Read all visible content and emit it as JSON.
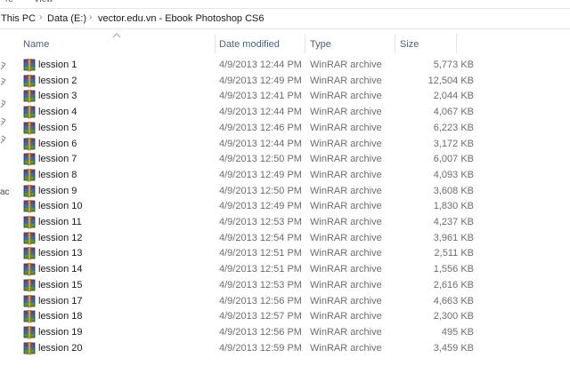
{
  "address": {
    "crumbs": [
      "This PC",
      "Data (E:)",
      "vector.edu.vn - Ebook Photoshop CS6"
    ]
  },
  "columns": {
    "name": "Name",
    "date_modified": "Date modified",
    "type": "Type",
    "size": "Size"
  },
  "nav_partial_letter": "ac",
  "files": [
    {
      "name": "lession 1",
      "date": "4/9/2013 12:44 PM",
      "type": "WinRAR archive",
      "size": "5,773 KB"
    },
    {
      "name": "lession 2",
      "date": "4/9/2013 12:49 PM",
      "type": "WinRAR archive",
      "size": "12,504 KB"
    },
    {
      "name": "lession 3",
      "date": "4/9/2013 12:41 PM",
      "type": "WinRAR archive",
      "size": "2,044 KB"
    },
    {
      "name": "lession 4",
      "date": "4/9/2013 12:44 PM",
      "type": "WinRAR archive",
      "size": "4,067 KB"
    },
    {
      "name": "lession 5",
      "date": "4/9/2013 12:46 PM",
      "type": "WinRAR archive",
      "size": "6,223 KB"
    },
    {
      "name": "lession 6",
      "date": "4/9/2013 12:44 PM",
      "type": "WinRAR archive",
      "size": "3,172 KB"
    },
    {
      "name": "lession 7",
      "date": "4/9/2013 12:50 PM",
      "type": "WinRAR archive",
      "size": "6,007 KB"
    },
    {
      "name": "lession 8",
      "date": "4/9/2013 12:49 PM",
      "type": "WinRAR archive",
      "size": "4,093 KB"
    },
    {
      "name": "lession 9",
      "date": "4/9/2013 12:50 PM",
      "type": "WinRAR archive",
      "size": "3,608 KB"
    },
    {
      "name": "lession 10",
      "date": "4/9/2013 12:49 PM",
      "type": "WinRAR archive",
      "size": "1,830 KB"
    },
    {
      "name": "lession 11",
      "date": "4/9/2013 12:53 PM",
      "type": "WinRAR archive",
      "size": "4,237 KB"
    },
    {
      "name": "lession 12",
      "date": "4/9/2013 12:54 PM",
      "type": "WinRAR archive",
      "size": "3,961 KB"
    },
    {
      "name": "lession 13",
      "date": "4/9/2013 12:51 PM",
      "type": "WinRAR archive",
      "size": "2,511 KB"
    },
    {
      "name": "lession 14",
      "date": "4/9/2013 12:51 PM",
      "type": "WinRAR archive",
      "size": "1,556 KB"
    },
    {
      "name": "lession 15",
      "date": "4/9/2013 12:53 PM",
      "type": "WinRAR archive",
      "size": "2,616 KB"
    },
    {
      "name": "lession 17",
      "date": "4/9/2013 12:56 PM",
      "type": "WinRAR archive",
      "size": "4,663 KB"
    },
    {
      "name": "lession 18",
      "date": "4/9/2013 12:57 PM",
      "type": "WinRAR archive",
      "size": "2,300 KB"
    },
    {
      "name": "lession 19",
      "date": "4/9/2013 12:56 PM",
      "type": "WinRAR archive",
      "size": "495 KB"
    },
    {
      "name": "lession 20",
      "date": "4/9/2013 12:59 PM",
      "type": "WinRAR archive",
      "size": "3,459 KB"
    }
  ],
  "colors": {
    "header_text": "#4c607a",
    "secondary_text": "#6d6d6d",
    "separator": "#e5e5e5"
  },
  "icons": {
    "file": "winrar-archive-icon",
    "sort": "sort-ascending-icon",
    "pin": "pin-icon",
    "breadcrumb_separator": "chevron-right-icon"
  }
}
